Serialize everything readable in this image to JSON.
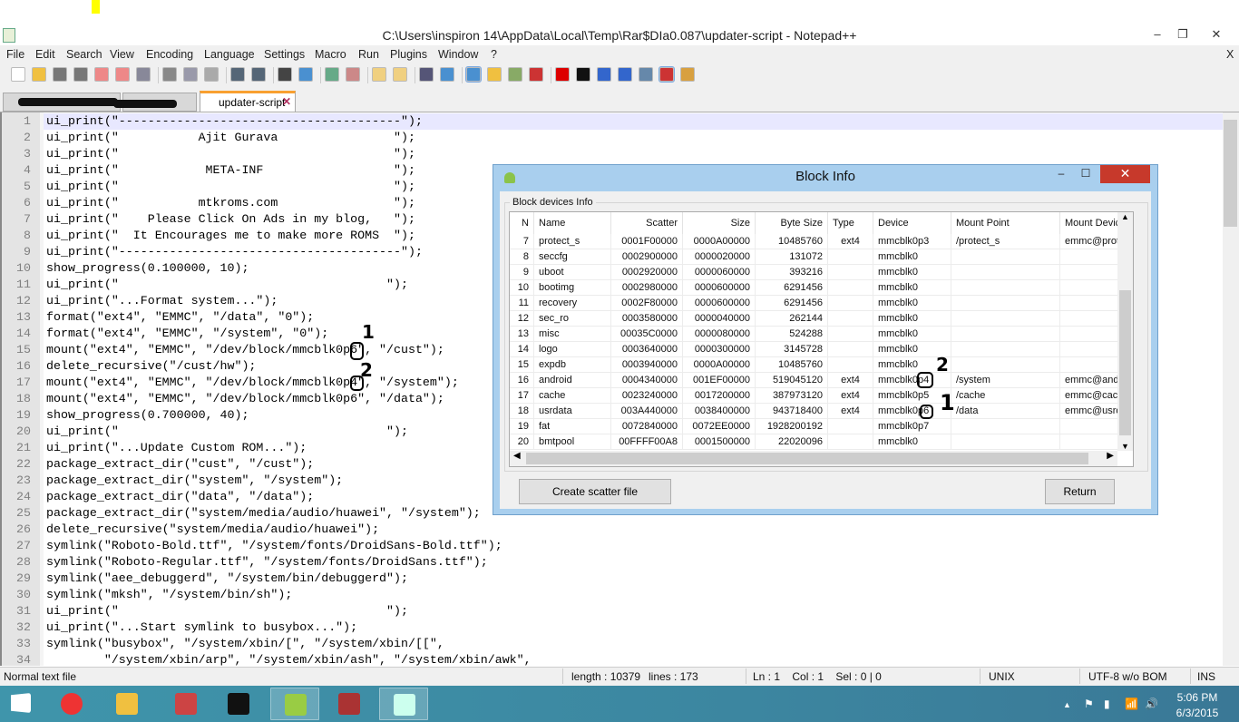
{
  "window": {
    "title": "C:\\Users\\inspiron 14\\AppData\\Local\\Temp\\Rar$DIa0.087\\updater-script - Notepad++",
    "minimize": "‒",
    "restore": "❐",
    "close": "✕",
    "menu_close": "X"
  },
  "menu": [
    "File",
    "Edit",
    "Search",
    "View",
    "Encoding",
    "Language",
    "Settings",
    "Macro",
    "Run",
    "Plugins",
    "Window",
    "?"
  ],
  "toolbar": [
    "new",
    "open",
    "save",
    "save-all",
    "close",
    "close-all",
    "print",
    "cut",
    "copy",
    "paste",
    "undo",
    "redo",
    "find",
    "replace",
    "zoom-in",
    "zoom-out",
    "sync-v",
    "sync-h",
    "word-wrap",
    "show-all",
    "indent-guide",
    "udl",
    "doc-map",
    "function-list",
    "record-macro",
    "stop-record",
    "play-macro",
    "run-multiple",
    "save-macro",
    "spell-check",
    "compare"
  ],
  "tabs": [
    {
      "label": ""
    },
    {
      "label": ""
    },
    {
      "label": "updater-script",
      "active": true
    }
  ],
  "editor": {
    "lines": [
      "ui_print(\"---------------------------------------\");",
      "ui_print(\"           Ajit Gurava                \");",
      "ui_print(\"                                      \");",
      "ui_print(\"            META-INF                  \");",
      "ui_print(\"                                      \");",
      "ui_print(\"           mtkroms.com                \");",
      "ui_print(\"    Please Click On Ads in my blog,   \");",
      "ui_print(\"  It Encourages me to make more ROMS  \");",
      "ui_print(\"---------------------------------------\");",
      "show_progress(0.100000, 10);",
      "ui_print(\"                                     \");",
      "ui_print(\"...Format system...\");",
      "format(\"ext4\", \"EMMC\", \"/data\", \"0\");",
      "format(\"ext4\", \"EMMC\", \"/system\", \"0\");",
      "mount(\"ext4\", \"EMMC\", \"/dev/block/mmcblk0p6\", \"/cust\");",
      "delete_recursive(\"/cust/hw\");",
      "mount(\"ext4\", \"EMMC\", \"/dev/block/mmcblk0p4\", \"/system\");",
      "mount(\"ext4\", \"EMMC\", \"/dev/block/mmcblk0p6\", \"/data\");",
      "show_progress(0.700000, 40);",
      "ui_print(\"                                     \");",
      "ui_print(\"...Update Custom ROM...\");",
      "package_extract_dir(\"cust\", \"/cust\");",
      "package_extract_dir(\"system\", \"/system\");",
      "package_extract_dir(\"data\", \"/data\");",
      "package_extract_dir(\"system/media/audio/huawei\", \"/system\");",
      "delete_recursive(\"system/media/audio/huawei\");",
      "symlink(\"Roboto-Bold.ttf\", \"/system/fonts/DroidSans-Bold.ttf\");",
      "symlink(\"Roboto-Regular.ttf\", \"/system/fonts/DroidSans.ttf\");",
      "symlink(\"aee_debuggerd\", \"/system/bin/debuggerd\");",
      "symlink(\"mksh\", \"/system/bin/sh\");",
      "ui_print(\"                                     \");",
      "ui_print(\"...Start symlink to busybox...\");",
      "symlink(\"busybox\", \"/system/xbin/[\", \"/system/xbin/[[\",",
      "        \"/system/xbin/arp\", \"/system/xbin/ash\", \"/system/xbin/awk\","
    ]
  },
  "statusbar": {
    "type": "Normal text file",
    "length": "length : 10379",
    "lines": "lines : 173",
    "pos": "Ln : 1    Col : 1    Sel : 0 | 0",
    "eol": "UNIX",
    "encoding": "UTF-8 w/o BOM",
    "mode": "INS"
  },
  "dialog": {
    "title": "Block Info",
    "close": "✕",
    "minimize": "–",
    "maximize": "☐",
    "group": "Block devices Info",
    "columns": [
      "N",
      "Name",
      "Scatter",
      "Size",
      "Byte Size",
      "Type",
      "Device",
      "Mount Point",
      "Mount Devic"
    ],
    "rows": [
      [
        "7",
        "protect_s",
        "0001F00000",
        "0000A00000",
        "10485760",
        "ext4",
        "mmcblk0p3",
        "/protect_s",
        "emmc@prote"
      ],
      [
        "8",
        "seccfg",
        "0002900000",
        "0000020000",
        "131072",
        "",
        "mmcblk0",
        "",
        ""
      ],
      [
        "9",
        "uboot",
        "0002920000",
        "0000060000",
        "393216",
        "",
        "mmcblk0",
        "",
        ""
      ],
      [
        "10",
        "bootimg",
        "0002980000",
        "0000600000",
        "6291456",
        "",
        "mmcblk0",
        "",
        ""
      ],
      [
        "11",
        "recovery",
        "0002F80000",
        "0000600000",
        "6291456",
        "",
        "mmcblk0",
        "",
        ""
      ],
      [
        "12",
        "sec_ro",
        "0003580000",
        "0000040000",
        "262144",
        "",
        "mmcblk0",
        "",
        ""
      ],
      [
        "13",
        "misc",
        "00035C0000",
        "0000080000",
        "524288",
        "",
        "mmcblk0",
        "",
        ""
      ],
      [
        "14",
        "logo",
        "0003640000",
        "0000300000",
        "3145728",
        "",
        "mmcblk0",
        "",
        ""
      ],
      [
        "15",
        "expdb",
        "0003940000",
        "0000A00000",
        "10485760",
        "",
        "mmcblk0",
        "",
        ""
      ],
      [
        "16",
        "android",
        "0004340000",
        "001EF00000",
        "519045120",
        "ext4",
        "mmcblk0p4",
        "/system",
        "emmc@andr"
      ],
      [
        "17",
        "cache",
        "0023240000",
        "0017200000",
        "387973120",
        "ext4",
        "mmcblk0p5",
        "/cache",
        "emmc@cacl"
      ],
      [
        "18",
        "usrdata",
        "003A440000",
        "0038400000",
        "943718400",
        "ext4",
        "mmcblk0p6",
        "/data",
        "emmc@usrd"
      ],
      [
        "19",
        "fat",
        "0072840000",
        "0072EE0000",
        "1928200192",
        "",
        "mmcblk0p7",
        "",
        ""
      ],
      [
        "20",
        "bmtpool",
        "00FFFF00A8",
        "0001500000",
        "22020096",
        "",
        "mmcblk0",
        "",
        ""
      ]
    ],
    "create_button": "Create scatter file",
    "return_button": "Return"
  },
  "annotations": {
    "mark1": "1",
    "mark2": "2"
  },
  "taskbar": {
    "apps": [
      "start",
      "chrome",
      "file-explorer",
      "snipping-tool",
      "command-prompt",
      "android-tool",
      "winrar",
      "notepad++"
    ],
    "time": "5:06 PM",
    "date": "6/3/2015",
    "tray": [
      "▲",
      "⚑",
      "▮",
      "📶",
      "🔊"
    ]
  },
  "colors": {
    "accent_tab": "#f8a030",
    "taskbar": "#3c86a0",
    "dialog_frame": "#a9cfee",
    "close_red": "#c7392b",
    "current_line": "#e8e8ff"
  }
}
